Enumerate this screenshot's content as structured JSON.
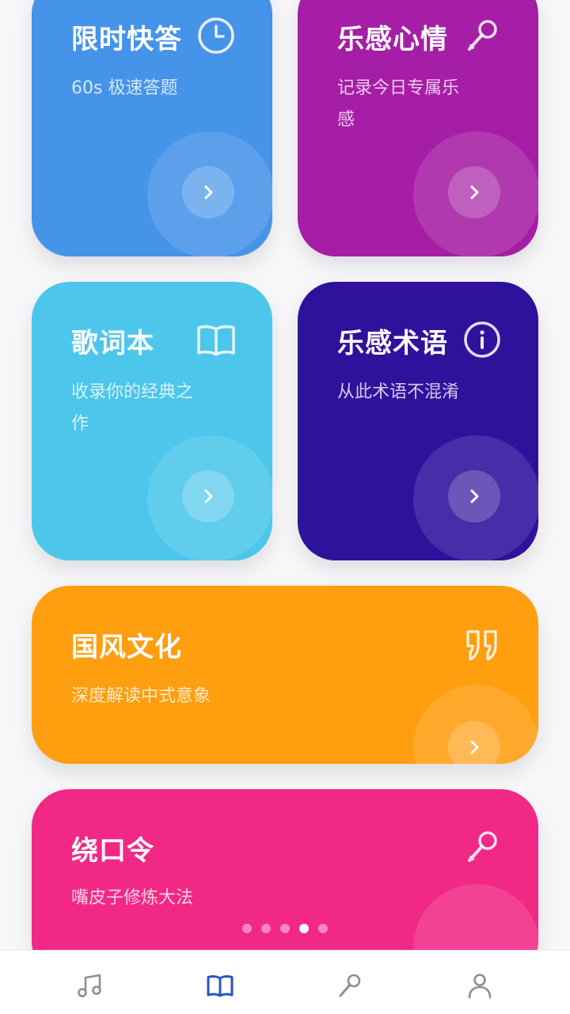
{
  "cards": [
    {
      "title": "限时快答",
      "subtitle": "60s 极速答题",
      "icon": "clock-icon",
      "color": "#4693ea"
    },
    {
      "title": "乐感心情",
      "subtitle": "记录今日专属乐感",
      "icon": "microphone-icon",
      "color": "#a61ea6"
    },
    {
      "title": "歌词本",
      "subtitle": "收录你的经典之作",
      "icon": "open-book-icon",
      "color": "#4cc6ea"
    },
    {
      "title": "乐感术语",
      "subtitle": "从此术语不混淆",
      "icon": "info-icon",
      "color": "#2e129c"
    },
    {
      "title": "国风文化",
      "subtitle": "深度解读中式意象",
      "icon": "quote-icon",
      "color": "#ff9e0f"
    },
    {
      "title": "绕口令",
      "subtitle": "嘴皮子修炼大法",
      "icon": "microphone-icon",
      "color": "#f22886"
    }
  ],
  "pager": {
    "count": 5,
    "active_index": 3
  },
  "tabbar": {
    "active_index": 1,
    "tabs": [
      {
        "label": "",
        "icon": "music-note-icon"
      },
      {
        "label": "",
        "icon": "book-icon"
      },
      {
        "label": "",
        "icon": "microphone-icon"
      },
      {
        "label": "",
        "icon": "user-icon"
      }
    ]
  }
}
